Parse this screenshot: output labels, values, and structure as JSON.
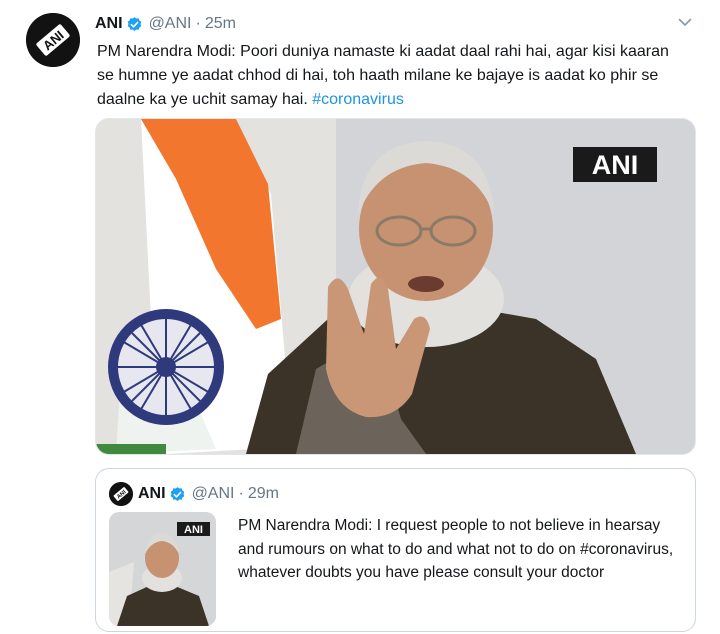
{
  "tweet": {
    "author_name": "ANI",
    "handle": "@ANI",
    "separator": "·",
    "time": "25m",
    "text_plain": "PM Narendra Modi: Poori duniya namaste ki aadat daal rahi hai, agar kisi kaaran se humne ye aadat chhod di hai, toh haath milane ke bajaye is aadat ko phir se daalne ka ye uchit samay hai. ",
    "hashtag": "#coronavirus",
    "media_watermark": "ANI"
  },
  "quoted": {
    "author_name": "ANI",
    "handle": "@ANI",
    "separator": "·",
    "time": "29m",
    "text": "PM Narendra Modi: I request people to not believe in hearsay and rumours on what to do and what not to do on #coronavirus, whatever doubts you have please consult your doctor",
    "thumb_watermark": "ANI"
  },
  "colors": {
    "link": "#1b95e0",
    "verified": "#1da1f2",
    "secondary_text": "#657786"
  },
  "icons": [
    "ani-logo-icon",
    "verified-badge-icon",
    "chevron-down-icon"
  ]
}
